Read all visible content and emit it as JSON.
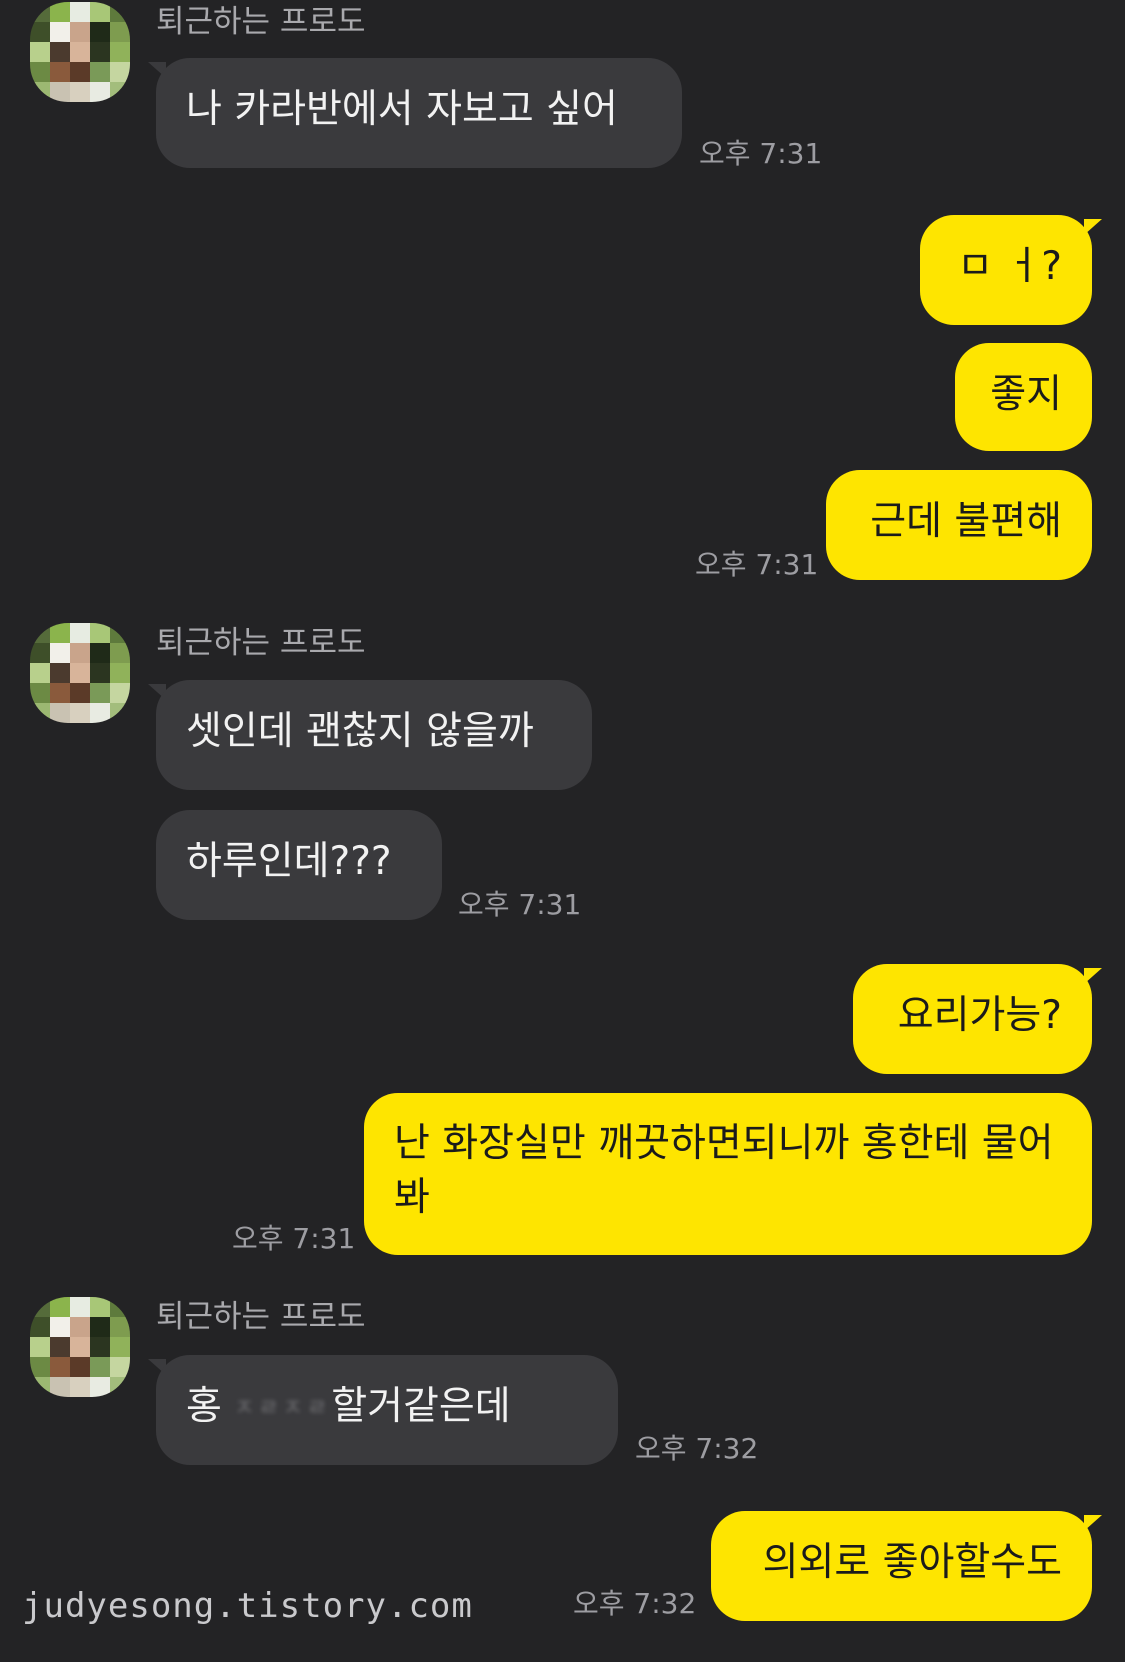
{
  "sender_name": "퇴근하는 프로도",
  "colors": {
    "background": "#232325",
    "incoming_bubble": "#3a3a3d",
    "outgoing_bubble": "#fee500",
    "timestamp": "#9d9da2"
  },
  "avatar_icon": "pixelated-avatar-icon",
  "messages": {
    "m1": "나 카라반에서 자보고 싶어",
    "m2": "ㅁ ㅓ?",
    "m3": "좋지",
    "m4": "근데 불편해",
    "m5": "셋인데 괜찮지 않을까",
    "m6": "하루인데???",
    "m7": "요리가능?",
    "m8": "난 화장실만 깨끗하면되니까 홍한테 물어봐",
    "m9_prefix": "홍",
    "m9_blurred": "ㅈㄹㅈㄹ",
    "m9_suffix": "할거같은데",
    "m10": "의외로 좋아할수도"
  },
  "times": {
    "t1": "오후 7:31",
    "t2": "오후 7:31",
    "t3": "오후 7:31",
    "t4": "오후 7:31",
    "t5": "오후 7:32",
    "t6": "오후 7:32"
  },
  "watermark": "judyesong.tistory.com"
}
